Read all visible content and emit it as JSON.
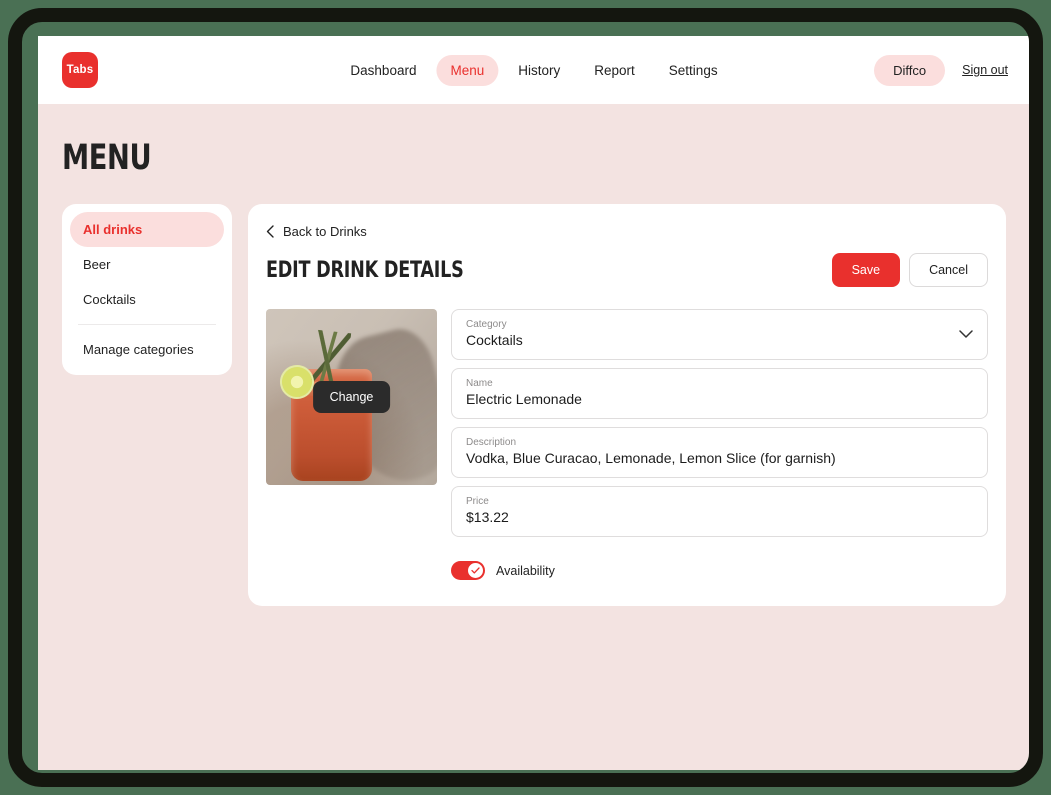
{
  "brand": {
    "logo_text": "Tabs",
    "accent": "#e9302d",
    "accent_soft": "#fbdedd"
  },
  "topbar": {
    "nav": [
      {
        "label": "Dashboard",
        "active": false
      },
      {
        "label": "Menu",
        "active": true
      },
      {
        "label": "History",
        "active": false
      },
      {
        "label": "Report",
        "active": false
      },
      {
        "label": "Settings",
        "active": false
      }
    ],
    "user": "Diffco",
    "signout": "Sign out"
  },
  "page": {
    "title": "MENU"
  },
  "sidebar": {
    "items": [
      {
        "label": "All drinks",
        "active": true
      },
      {
        "label": "Beer",
        "active": false
      },
      {
        "label": "Cocktails",
        "active": false
      }
    ],
    "manage": "Manage categories"
  },
  "card": {
    "back_label": "Back to Drinks",
    "title": "EDIT DRINK DETAILS",
    "save_label": "Save",
    "cancel_label": "Cancel"
  },
  "photo": {
    "change_label": "Change"
  },
  "form": {
    "category": {
      "label": "Category",
      "value": "Cocktails"
    },
    "name": {
      "label": "Name",
      "value": "Electric Lemonade"
    },
    "description": {
      "label": "Description",
      "value": "Vodka, Blue Curacao, Lemonade, Lemon Slice (for garnish)"
    },
    "price": {
      "label": "Price",
      "value": "$13.22"
    },
    "availability": {
      "label": "Availability",
      "enabled": true
    }
  }
}
